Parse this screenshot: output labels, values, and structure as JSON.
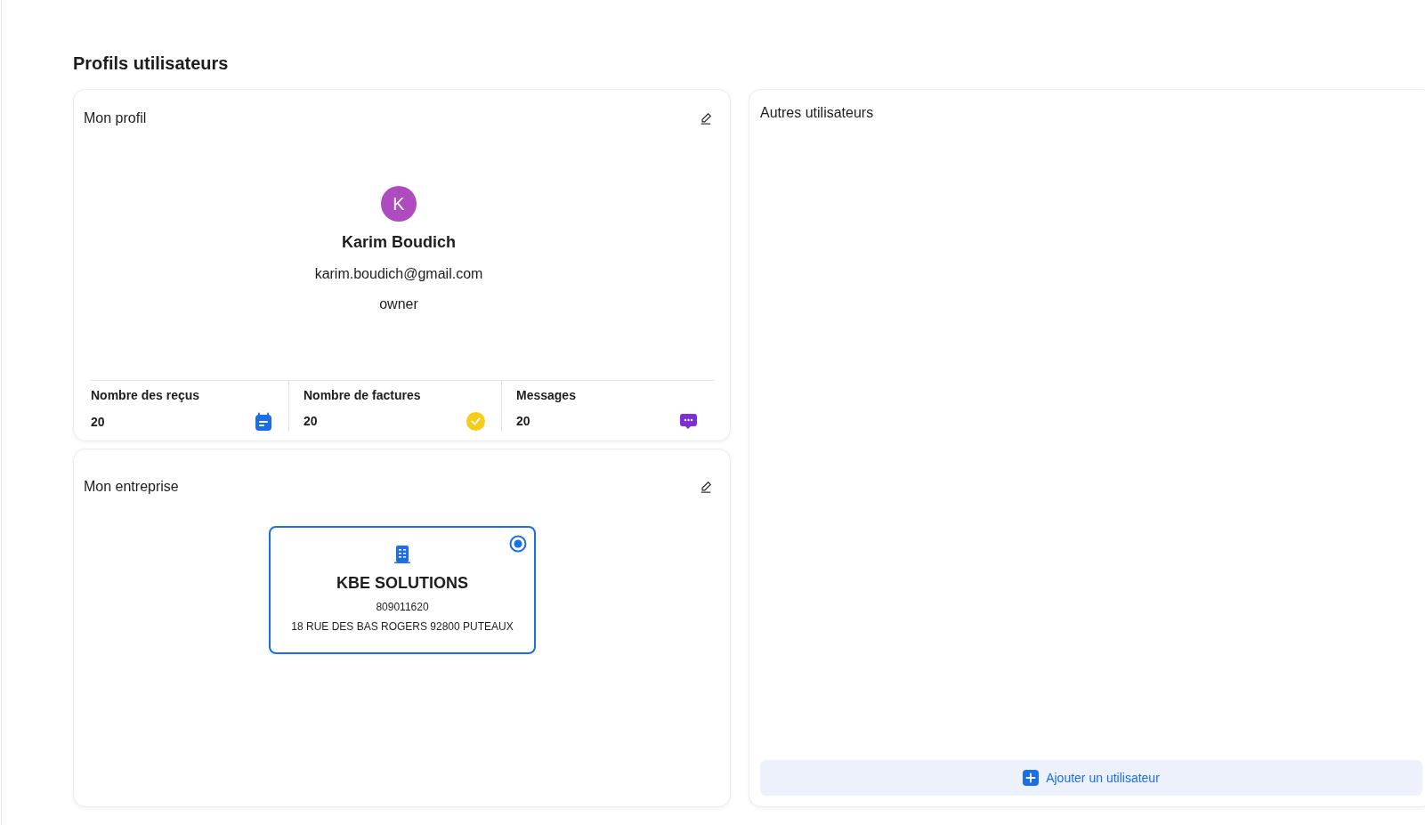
{
  "page_title": "Profils utilisateurs",
  "my_profile": {
    "title": "Mon profil",
    "avatar_letter": "K",
    "name": "Karim Boudich",
    "email": "karim.boudich@gmail.com",
    "role": "owner",
    "stats": [
      {
        "label": "Nombre des reçus",
        "value": "20",
        "kind": "calendar"
      },
      {
        "label": "Nombre de factures",
        "value": "20",
        "kind": "check"
      },
      {
        "label": "Messages",
        "value": "20",
        "kind": "message"
      }
    ]
  },
  "my_company": {
    "title": "Mon entreprise",
    "companies": [
      {
        "name": "KBE SOLUTIONS",
        "number": "809011620",
        "address": "18 RUE DES BAS ROGERS 92800 PUTEAUX",
        "selected": true
      }
    ]
  },
  "other_users": {
    "title": "Autres utilisateurs",
    "add_button": "Ajouter un utilisateur"
  }
}
